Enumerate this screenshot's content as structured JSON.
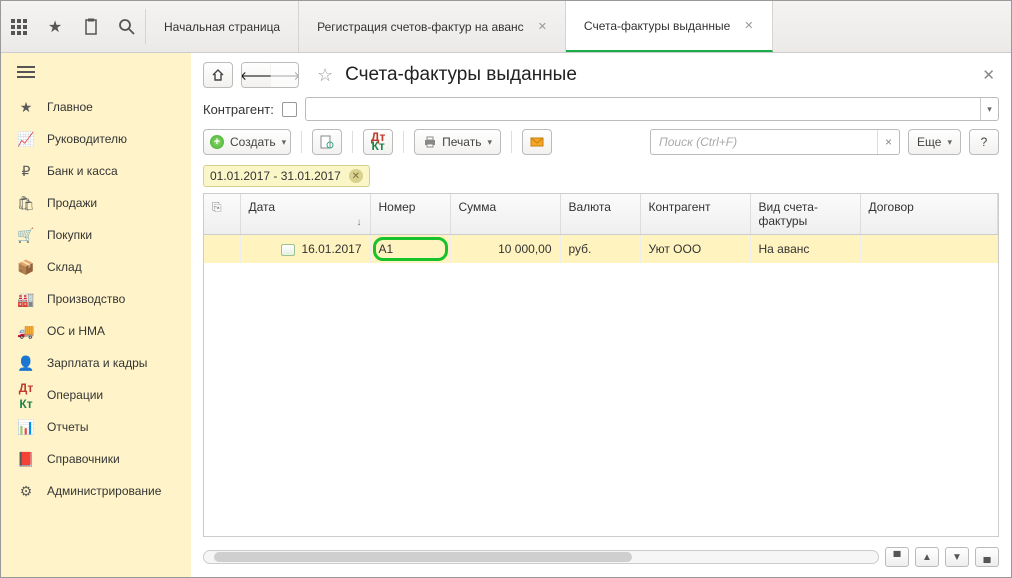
{
  "tabs": {
    "home": "Начальная страница",
    "reg": "Регистрация счетов-фактур на аванс",
    "active": "Счета-фактуры выданные"
  },
  "sidebar": {
    "items": [
      {
        "icon": "menu",
        "label": ""
      },
      {
        "icon": "≡",
        "label": "Главное"
      },
      {
        "icon": "chart",
        "label": "Руководителю"
      },
      {
        "icon": "rub",
        "label": "Банк и касса"
      },
      {
        "icon": "bag",
        "label": "Продажи"
      },
      {
        "icon": "cart",
        "label": "Покупки"
      },
      {
        "icon": "box",
        "label": "Склад"
      },
      {
        "icon": "factory",
        "label": "Производство"
      },
      {
        "icon": "truck",
        "label": "ОС и НМА"
      },
      {
        "icon": "person",
        "label": "Зарплата и кадры"
      },
      {
        "icon": "dk",
        "label": "Операции"
      },
      {
        "icon": "bars",
        "label": "Отчеты"
      },
      {
        "icon": "book",
        "label": "Справочники"
      },
      {
        "icon": "gear",
        "label": "Администрирование"
      }
    ]
  },
  "page": {
    "title": "Счета-фактуры выданные",
    "contragent_label": "Контрагент:",
    "contragent_value": ""
  },
  "toolbar": {
    "create": "Создать",
    "print": "Печать",
    "search_placeholder": "Поиск (Ctrl+F)",
    "more": "Еще",
    "help": "?"
  },
  "date_filter": "01.01.2017 - 31.01.2017",
  "columns": {
    "attach": "",
    "date": "Дата",
    "number": "Номер",
    "sum": "Сумма",
    "currency": "Валюта",
    "contragent": "Контрагент",
    "type": "Вид счета-фактуры",
    "contract": "Договор"
  },
  "rows": [
    {
      "date": "16.01.2017",
      "number": "А1",
      "sum": "10 000,00",
      "currency": "руб.",
      "contragent": "Уют ООО",
      "type": "На аванс",
      "contract": ""
    }
  ]
}
